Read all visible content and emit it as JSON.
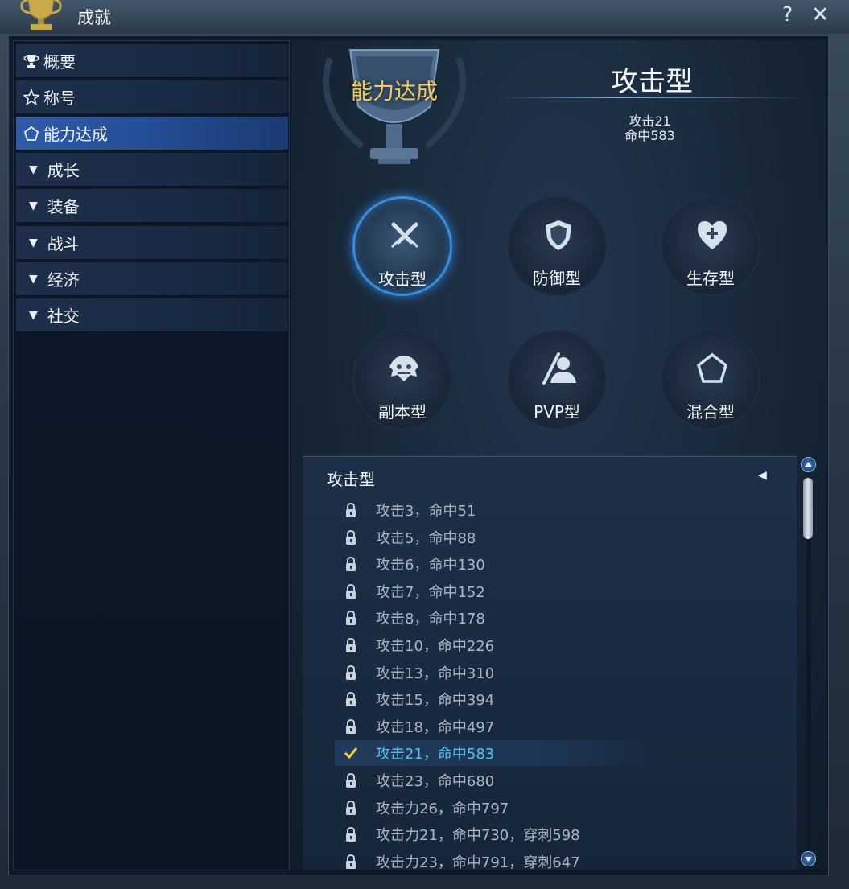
{
  "window": {
    "title": "成就",
    "help": "?",
    "close": "✕"
  },
  "sidebar": {
    "items": [
      {
        "label": "概要",
        "icon": "trophy-icon"
      },
      {
        "label": "称号",
        "icon": "star-icon"
      },
      {
        "label": "能力达成",
        "icon": "pentagon-icon",
        "active": true
      },
      {
        "label": "成长",
        "icon": "triangle-down-icon"
      },
      {
        "label": "装备",
        "icon": "triangle-down-icon"
      },
      {
        "label": "战斗",
        "icon": "triangle-down-icon"
      },
      {
        "label": "经济",
        "icon": "triangle-down-icon"
      },
      {
        "label": "社交",
        "icon": "triangle-down-icon"
      }
    ]
  },
  "header": {
    "cup_label": "能力达成",
    "type_title": "攻击型",
    "stats": [
      "攻击21",
      "命中583"
    ]
  },
  "categories": [
    {
      "label": "攻击型",
      "icon": "sword-icon",
      "active": true
    },
    {
      "label": "防御型",
      "icon": "shield-icon"
    },
    {
      "label": "生存型",
      "icon": "heart-plus-icon"
    },
    {
      "label": "副本型",
      "icon": "monster-icon"
    },
    {
      "label": "PVP型",
      "icon": "pvp-icon"
    },
    {
      "label": "混合型",
      "icon": "pentagon-icon"
    }
  ],
  "list": {
    "header": "攻击型",
    "rows": [
      {
        "text": "攻击3，命中51",
        "status": "locked"
      },
      {
        "text": "攻击5，命中88",
        "status": "locked"
      },
      {
        "text": "攻击6，命中130",
        "status": "locked"
      },
      {
        "text": "攻击7，命中152",
        "status": "locked"
      },
      {
        "text": "攻击8，命中178",
        "status": "locked"
      },
      {
        "text": "攻击10，命中226",
        "status": "locked"
      },
      {
        "text": "攻击13，命中310",
        "status": "locked"
      },
      {
        "text": "攻击15，命中394",
        "status": "locked"
      },
      {
        "text": "攻击18，命中497",
        "status": "locked"
      },
      {
        "text": "攻击21，命中583",
        "status": "selected"
      },
      {
        "text": "攻击23，命中680",
        "status": "locked"
      },
      {
        "text": "攻击力26，命中797",
        "status": "locked"
      },
      {
        "text": "攻击力21，命中730，穿刺598",
        "status": "locked"
      },
      {
        "text": "攻击力23，命中791，穿刺647",
        "status": "locked"
      }
    ]
  },
  "colors": {
    "accent": "#2f7fcf",
    "gold": "#f2cd5c",
    "selected_text": "#4fc4ee"
  }
}
